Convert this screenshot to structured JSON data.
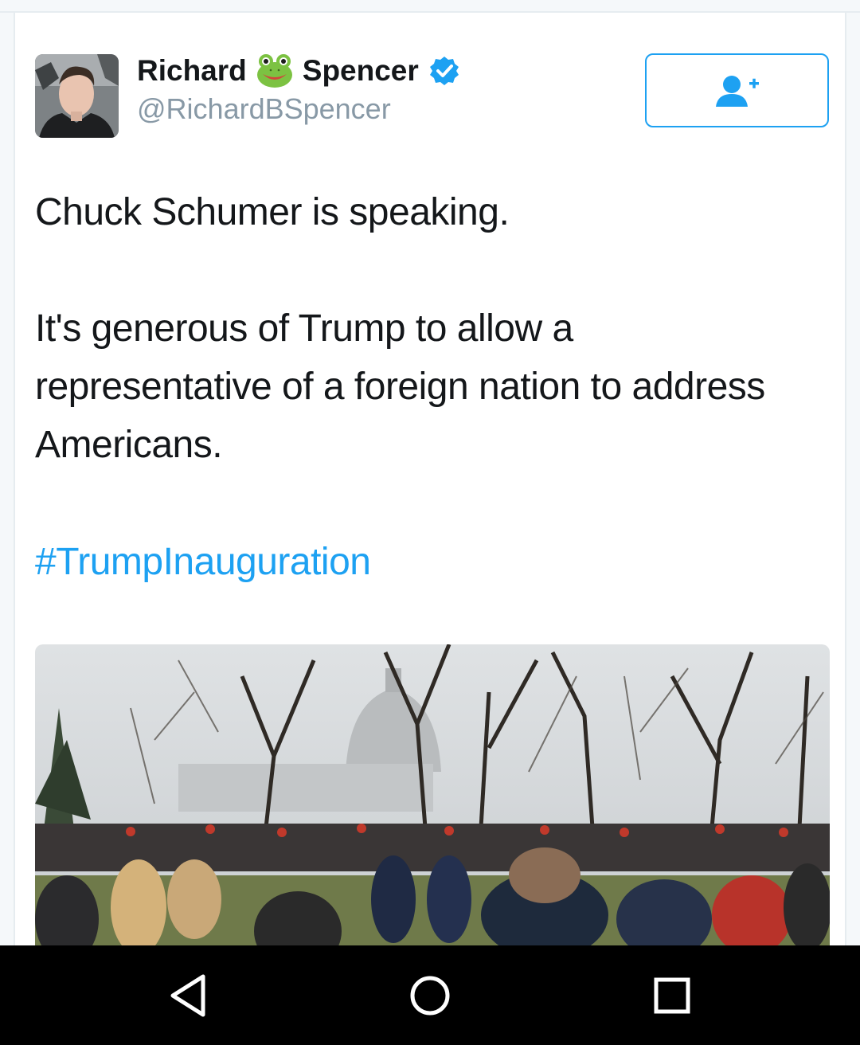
{
  "author": {
    "name_first": "Richard",
    "name_last": "Spencer",
    "handle": "@RichardBSpencer",
    "verified": true,
    "name_emoji": "frog-face-icon"
  },
  "follow_button": {
    "icon": "add-user-icon",
    "color": "#1da1f2"
  },
  "tweet": {
    "line1": "Chuck Schumer is speaking.",
    "line2": "It's generous of Trump to allow a",
    "line3": "representative of a foreign nation to address",
    "line4": "Americans.",
    "hashtag": "#TrumpInauguration"
  },
  "media": {
    "icon": "attached-photo"
  },
  "system_nav": {
    "back": "back-icon",
    "home": "home-icon",
    "recents": "recents-icon"
  },
  "colors": {
    "accent": "#1da1f2",
    "text": "#14171a",
    "secondary": "#8899a6"
  }
}
